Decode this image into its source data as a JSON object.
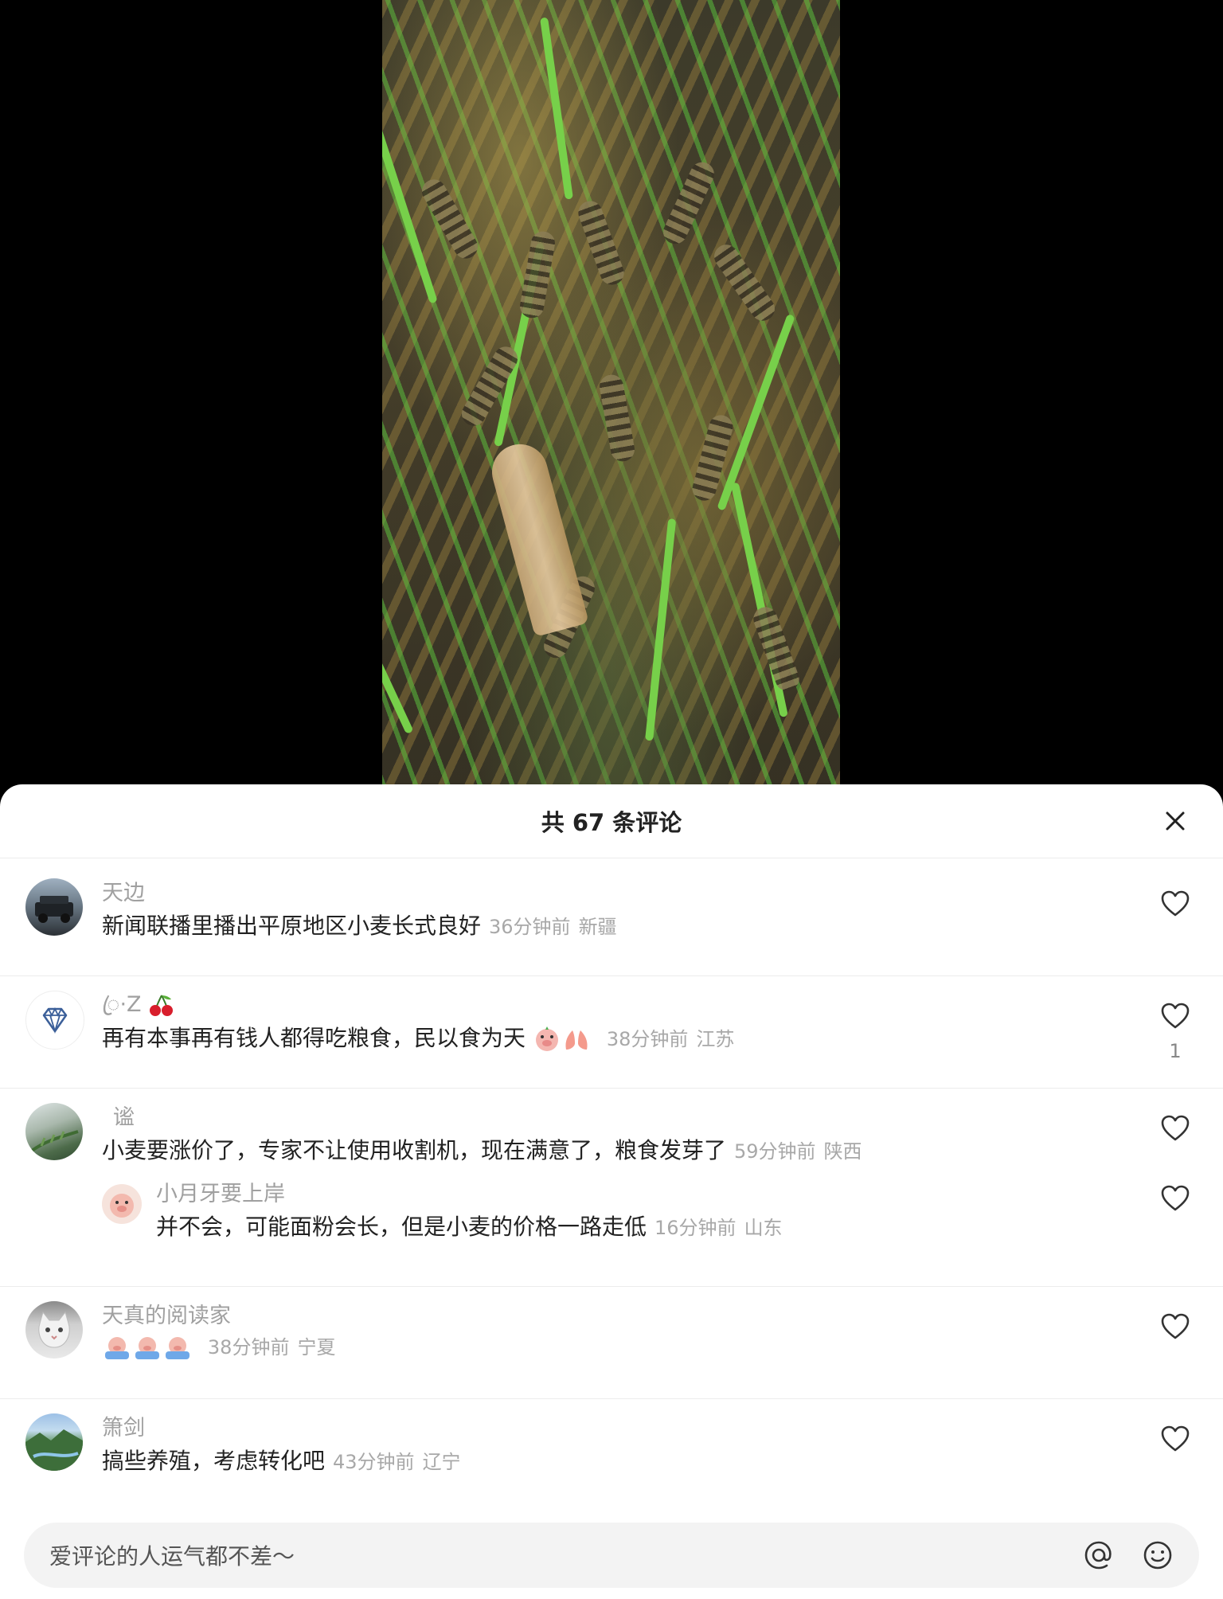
{
  "sheet": {
    "title": "共 67 条评论"
  },
  "comments": [
    {
      "name": "天边",
      "text": "新闻联播里播出平原地区小麦长式良好",
      "time": "36分钟前",
      "location": "新疆",
      "likes": ""
    },
    {
      "name": "ꦿ·Z",
      "name_emoji": "cherry",
      "text": "再有本事再有钱人都得吃粮食，民以食为天",
      "text_emoji": [
        "pig-face",
        "praying-hands"
      ],
      "time": "38分钟前",
      "location": "江苏",
      "likes": "1"
    },
    {
      "name": "谧",
      "text": "小麦要涨价了，专家不让使用收割机，现在满意了，粮食发芽了",
      "time": "59分钟前",
      "location": "陕西",
      "likes": "",
      "reply": {
        "name": "小月牙要上岸",
        "text": "并不会，可能面粉会长，但是小麦的价格一路走低",
        "time": "16分钟前",
        "location": "山东",
        "likes": ""
      }
    },
    {
      "name": "天真的阅读家",
      "text": "",
      "text_emoji": [
        "crying-pig",
        "crying-pig",
        "crying-pig"
      ],
      "time": "38分钟前",
      "location": "宁夏",
      "likes": ""
    },
    {
      "name": "箫剑",
      "text": "搞些养殖，考虑转化吧",
      "time": "43分钟前",
      "location": "辽宁",
      "likes": ""
    }
  ],
  "input": {
    "placeholder": "爱评论的人运气都不差～"
  },
  "icons": {
    "close": "close-icon",
    "like": "heart-outline-icon",
    "mention": "at-icon",
    "emoji": "smiley-icon"
  }
}
